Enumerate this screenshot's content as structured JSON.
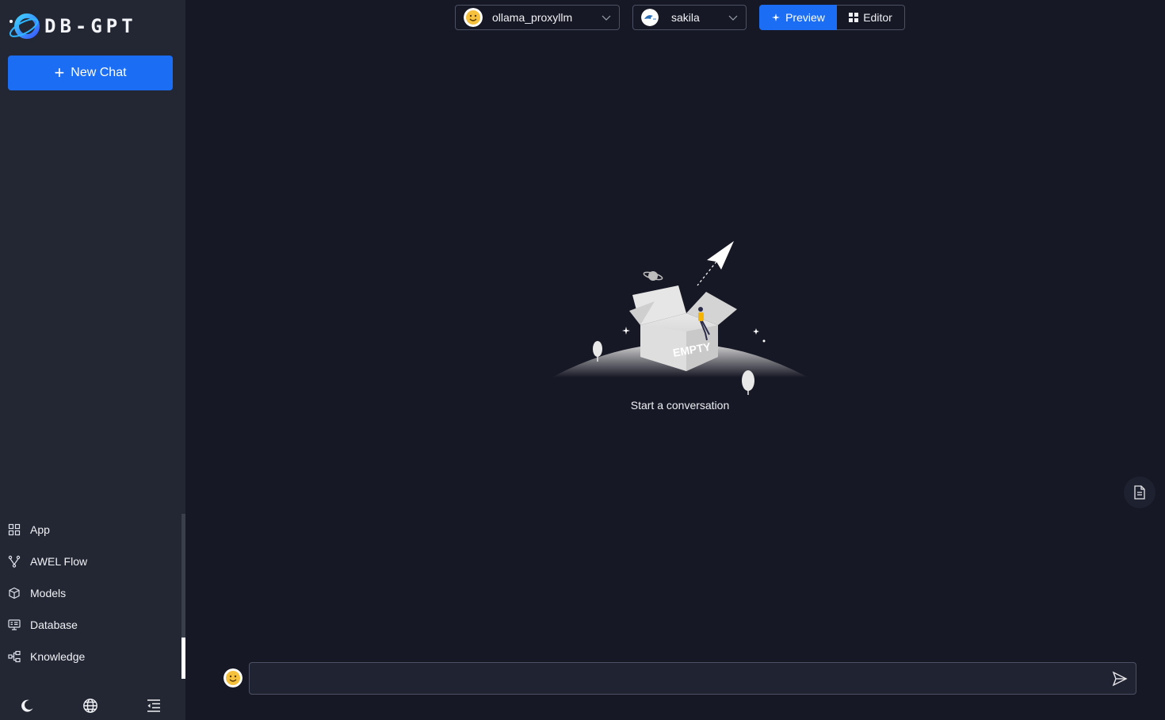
{
  "app": {
    "logo_text": "DB-GPT"
  },
  "sidebar": {
    "new_chat_label": "New Chat",
    "items": [
      {
        "label": "App",
        "icon": "app-grid-icon"
      },
      {
        "label": "AWEL Flow",
        "icon": "flow-icon"
      },
      {
        "label": "Models",
        "icon": "cube-icon"
      },
      {
        "label": "Database",
        "icon": "database-icon"
      },
      {
        "label": "Knowledge",
        "icon": "knowledge-icon"
      }
    ],
    "bottom": [
      "moon-icon",
      "globe-icon",
      "collapse-menu-icon"
    ]
  },
  "header": {
    "model_select": {
      "value": "ollama_proxyllm",
      "icon": "ollama-avatar"
    },
    "db_select": {
      "value": "sakila",
      "icon": "sakila-avatar"
    },
    "modes": [
      {
        "label": "Preview",
        "active": true
      },
      {
        "label": "Editor",
        "active": false
      }
    ]
  },
  "empty_state": {
    "illustration_text": "EMPTY",
    "message": "Start a conversation"
  },
  "chat_input": {
    "value": "",
    "placeholder": ""
  },
  "colors": {
    "accent": "#1b6ef3",
    "sidebar_bg": "#232734",
    "main_bg": "#171825"
  }
}
